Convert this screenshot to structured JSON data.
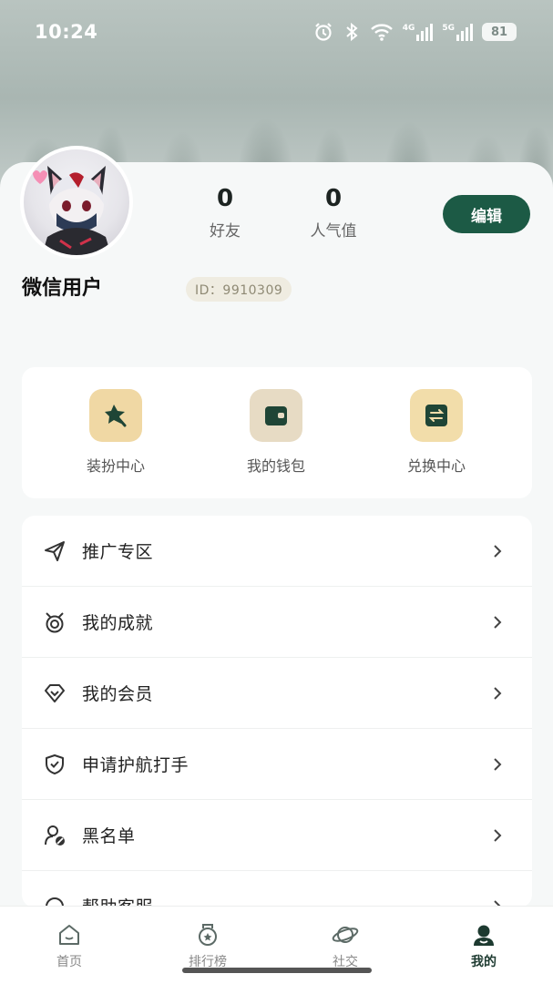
{
  "status_bar": {
    "time": "10:24",
    "battery": "81",
    "net_4g": "4G",
    "net_5g": "5G"
  },
  "profile": {
    "username": "微信用户",
    "user_id": "ID：9910309",
    "stats": [
      {
        "value": "0",
        "label": "好友"
      },
      {
        "value": "0",
        "label": "人气值"
      }
    ],
    "edit_label": "编辑"
  },
  "quick_actions": [
    {
      "label": "装扮中心",
      "icon": "costume-pin-icon"
    },
    {
      "label": "我的钱包",
      "icon": "wallet-icon"
    },
    {
      "label": "兑换中心",
      "icon": "exchange-icon"
    }
  ],
  "menu": [
    {
      "label": "推广专区",
      "icon": "paper-plane-icon"
    },
    {
      "label": "我的成就",
      "icon": "medal-icon"
    },
    {
      "label": "我的会员",
      "icon": "diamond-icon"
    },
    {
      "label": "申请护航打手",
      "icon": "shield-check-icon"
    },
    {
      "label": "黑名单",
      "icon": "user-block-icon"
    },
    {
      "label": "帮助客服",
      "icon": "help-icon"
    }
  ],
  "bottom_nav": [
    {
      "label": "首页",
      "icon": "home-icon",
      "active": false
    },
    {
      "label": "排行榜",
      "icon": "ranking-icon",
      "active": false
    },
    {
      "label": "社交",
      "icon": "planet-icon",
      "active": false
    },
    {
      "label": "我的",
      "icon": "profile-icon",
      "active": true
    }
  ],
  "colors": {
    "primary": "#1c5a45",
    "quick_costume_bg": "#f0d8a4",
    "quick_wallet_bg": "#e7dbc4",
    "quick_exchange_bg": "#f2ddaa"
  }
}
